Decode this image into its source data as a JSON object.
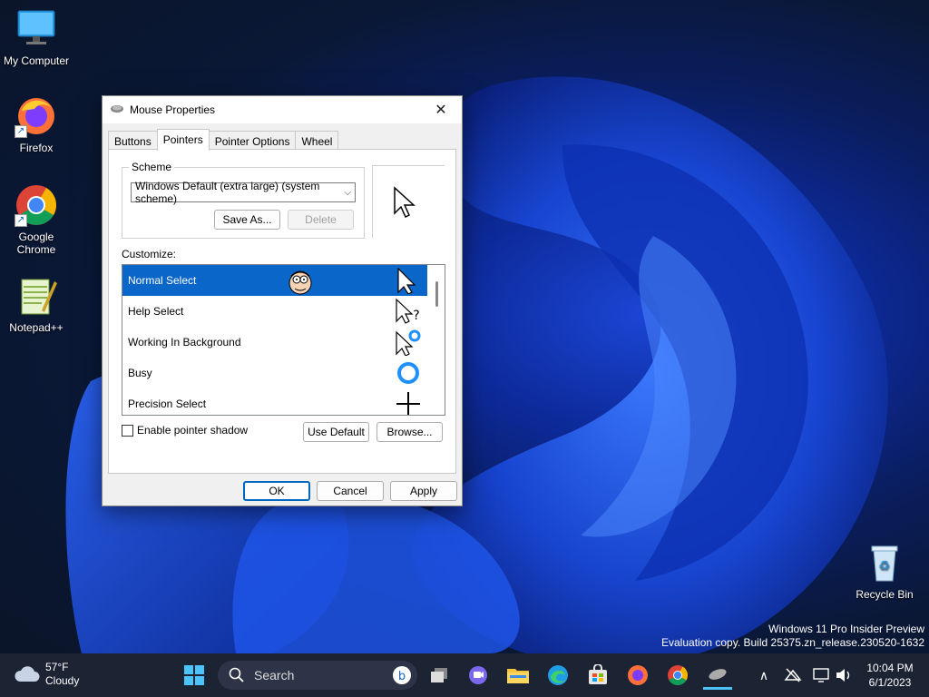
{
  "desktop": {
    "icons": [
      {
        "label": "My Computer"
      },
      {
        "label": "Firefox"
      },
      {
        "label": "Google Chrome"
      },
      {
        "label": "Notepad++"
      },
      {
        "label": "Recycle Bin"
      }
    ],
    "watermark": {
      "line1": "Windows 11 Pro Insider Preview",
      "line2": "Evaluation copy. Build 25375.zn_release.230520-1632"
    }
  },
  "dialog": {
    "title": "Mouse Properties",
    "close_glyph": "✕",
    "tabs": [
      {
        "label": "Buttons",
        "active": false
      },
      {
        "label": "Pointers",
        "active": true
      },
      {
        "label": "Pointer Options",
        "active": false
      },
      {
        "label": "Wheel",
        "active": false
      }
    ],
    "scheme": {
      "legend": "Scheme",
      "selected": "Windows Default (extra large) (system scheme)",
      "save_as_label": "Save As...",
      "delete_label": "Delete"
    },
    "customize_label": "Customize:",
    "pointers": [
      {
        "name": "Normal Select",
        "selected": true,
        "icon": "arrow-cursor-icon"
      },
      {
        "name": "Help Select",
        "selected": false,
        "icon": "help-cursor-icon"
      },
      {
        "name": "Working In Background",
        "selected": false,
        "icon": "working-cursor-icon"
      },
      {
        "name": "Busy",
        "selected": false,
        "icon": "busy-cursor-icon"
      },
      {
        "name": "Precision Select",
        "selected": false,
        "icon": "crosshair-cursor-icon"
      }
    ],
    "shadow_label": "Enable pointer shadow",
    "use_default_label": "Use Default",
    "browse_label": "Browse...",
    "ok_label": "OK",
    "cancel_label": "Cancel",
    "apply_label": "Apply"
  },
  "taskbar": {
    "weather_temp": "57°F",
    "weather_desc": "Cloudy",
    "search_label": "Search",
    "time": "10:04 PM",
    "date": "6/1/2023"
  },
  "colors": {
    "accent": "#0a66c8",
    "taskbar": "#1c2333"
  }
}
